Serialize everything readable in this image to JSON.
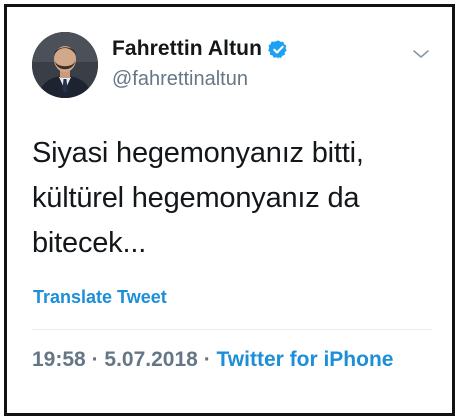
{
  "author": {
    "display_name": "Fahrettin Altun",
    "handle": "@fahrettinaltun",
    "verified": true,
    "avatar_icon": "profile-photo"
  },
  "tweet": {
    "text": "Siyasi hegemonyanız bitti,\nkültürel hegemonyanız da\nbitecek..."
  },
  "actions": {
    "translate_label": "Translate Tweet",
    "more_icon": "chevron-down-icon"
  },
  "meta": {
    "time": "19:58",
    "separator": "·",
    "date": "5.07.2018",
    "source": "Twitter for iPhone"
  },
  "colors": {
    "link": "#1c8fd8",
    "verified": "#1da1f2",
    "text": "#14171a",
    "muted": "#657786",
    "frame": "#111111"
  }
}
